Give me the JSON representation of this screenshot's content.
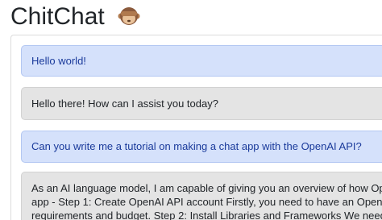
{
  "header": {
    "title": "ChitChat",
    "emoji": "see-no-evil-monkey"
  },
  "messages": [
    {
      "role": "user",
      "text": "Hello world!"
    },
    {
      "role": "assistant",
      "text": "Hello there! How can I assist you today?"
    },
    {
      "role": "user",
      "text": "Can you write me a tutorial on making a chat app with the OpenAI API?"
    },
    {
      "role": "assistant",
      "lines": [
        "As an AI language model, I am capable of giving you an overview of how OpenAI is u",
        "app - Step 1: Create OpenAI API account Firstly, you need to have an OpenAI API ac",
        "requirements and budget. Step 2: Install Libraries and Frameworks We need to install"
      ]
    }
  ],
  "colors": {
    "user_bg": "#d5e1fb",
    "user_text": "#1a3a9b",
    "assistant_bg": "#e4e4e4"
  }
}
